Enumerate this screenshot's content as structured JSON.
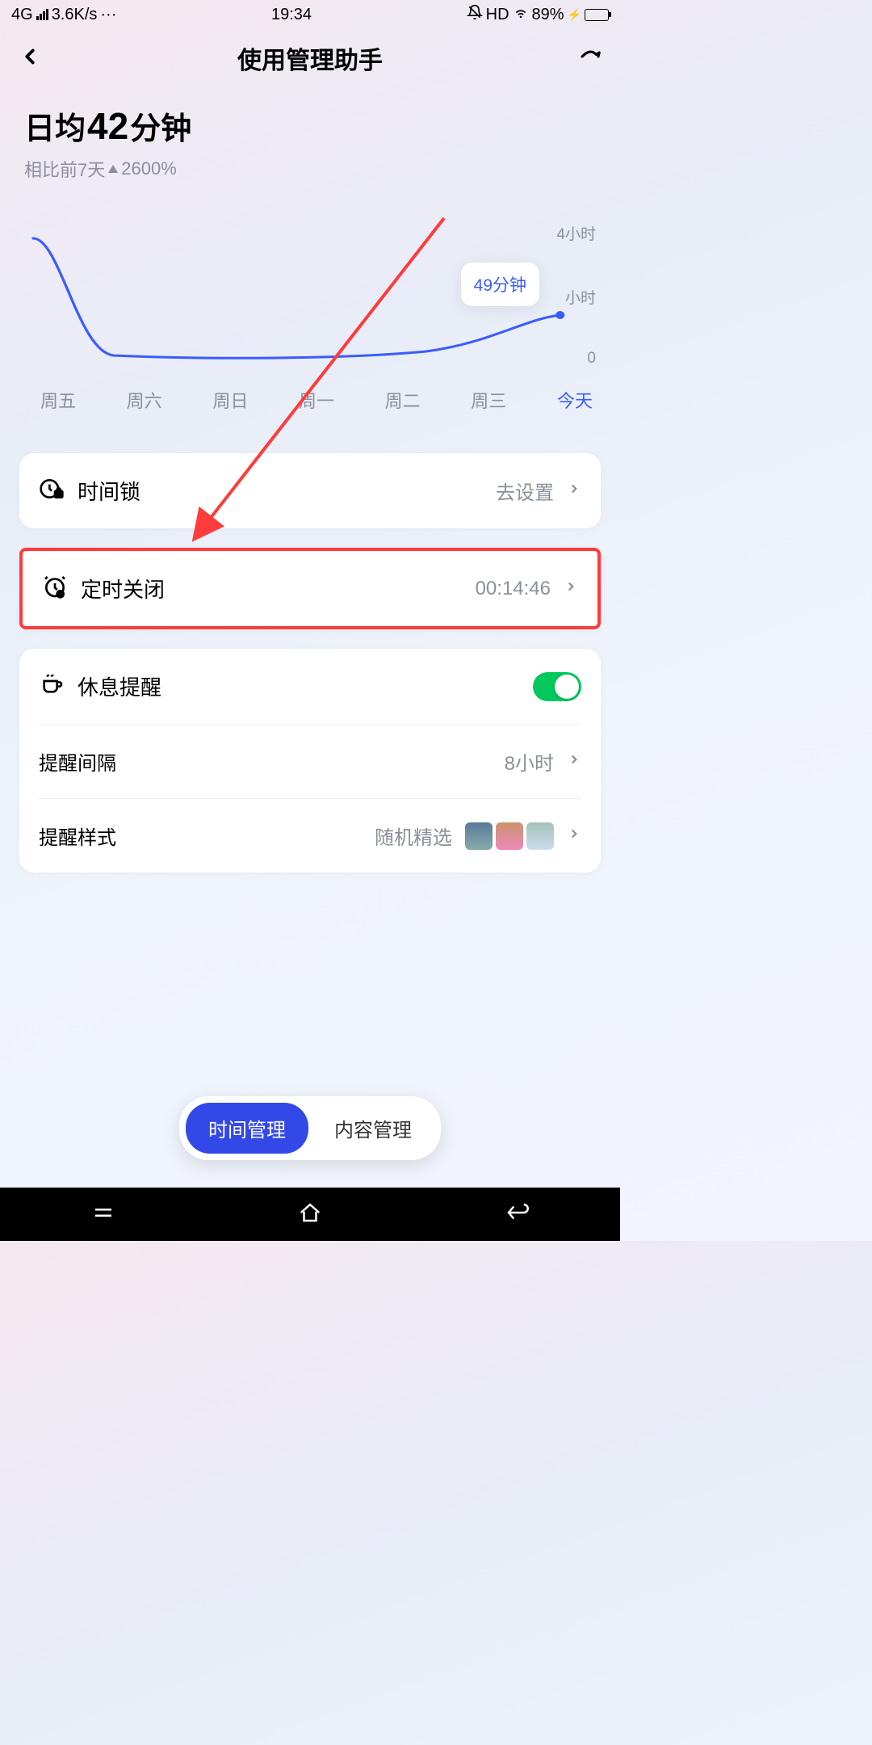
{
  "status": {
    "network": "4G",
    "speed": "3.6K/s",
    "dots": "···",
    "time": "19:34",
    "hd": "HD",
    "battery_pct": "89%",
    "battery_fill": 89
  },
  "header": {
    "title": "使用管理助手"
  },
  "summary": {
    "prefix": "日均",
    "value": "42",
    "unit": "分钟",
    "compare_prefix": "相比前7天",
    "compare_value": "2600%"
  },
  "chart_data": {
    "type": "line",
    "categories": [
      "周五",
      "周六",
      "周日",
      "周一",
      "周二",
      "周三",
      "今天"
    ],
    "values": [
      210,
      10,
      10,
      10,
      12,
      35,
      49
    ],
    "ylim": [
      0,
      240
    ],
    "y_ticks": [
      "4小时",
      "小时",
      "0"
    ],
    "tooltip": {
      "index": 6,
      "label": "49分钟"
    }
  },
  "settings": {
    "time_lock": {
      "label": "时间锁",
      "value": "去设置"
    },
    "scheduled_close": {
      "label": "定时关闭",
      "value": "00:14:46"
    },
    "rest_reminder": {
      "label": "休息提醒",
      "on": true
    },
    "interval": {
      "label": "提醒间隔",
      "value": "8小时"
    },
    "style": {
      "label": "提醒样式",
      "value": "随机精选",
      "thumbs": [
        "#5a7a9a",
        "#c9956b",
        "#a5c0b8"
      ]
    }
  },
  "tabs": {
    "active": "时间管理",
    "inactive": "内容管理"
  }
}
